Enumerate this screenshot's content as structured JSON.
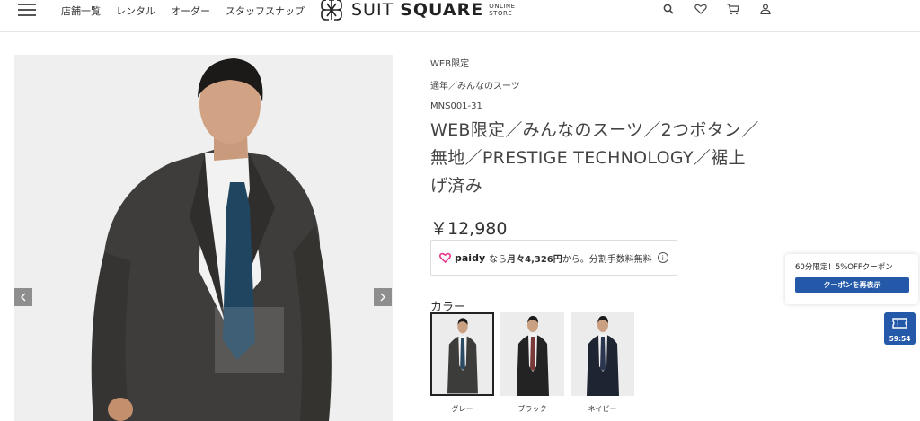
{
  "header": {
    "nav": [
      "店舗一覧",
      "レンタル",
      "オーダー",
      "スタッフスナップ"
    ],
    "logo": {
      "brand_light": "SUIT ",
      "brand_bold": "SQUARE",
      "sub_line1": "ONLINE",
      "sub_line2": "STORE"
    },
    "icons": [
      "search-icon",
      "heart-icon",
      "cart-icon",
      "user-icon"
    ]
  },
  "gallery": {
    "prev_icon": "chevron-left-icon",
    "next_icon": "chevron-right-icon"
  },
  "product": {
    "tag1": "WEB限定",
    "tag2": "通年／みんなのスーツ",
    "code": "MNS001-31",
    "title": "WEB限定／みんなのスーツ／2つボタン／無地／PRESTIGE TECHNOLOGY／裾上げ済み",
    "price": "￥12,980",
    "paidy": {
      "brand": "paidy",
      "prefix": "なら",
      "monthly": "月々4,326円",
      "suffix": "から。分割手数料無料"
    },
    "color_label": "カラー",
    "colors": [
      {
        "name": "グレー",
        "suit_color": "#3c3c3a",
        "tie_color": "#2b4a63"
      },
      {
        "name": "ブラック",
        "suit_color": "#232323",
        "tie_color": "#7a3a3a"
      },
      {
        "name": "ネイビー",
        "suit_color": "#1f2433",
        "tie_color": "#2a3550"
      }
    ]
  },
  "coupon": {
    "text": "60分限定！5%OFFクーポン",
    "button": "クーポンを再表示",
    "timer": "59:54"
  },
  "colors": {
    "accent": "#2459a9",
    "paidy_pink": "#e8368f"
  }
}
